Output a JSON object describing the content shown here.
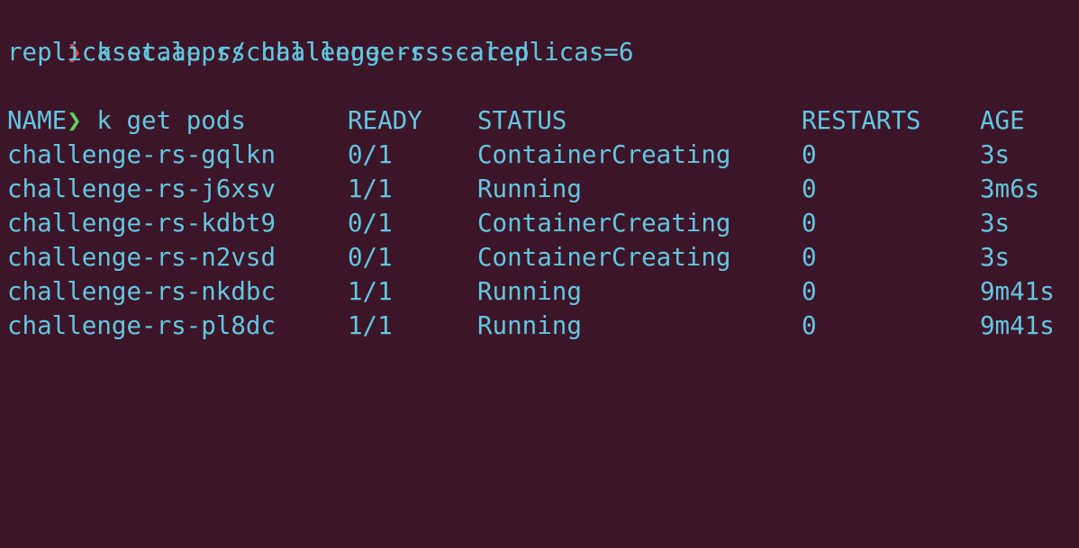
{
  "terminal": {
    "commands": [
      {
        "prompt": "❯",
        "text": "k scale rs challenge-rs --replicas=6",
        "status": "error"
      },
      {
        "output": "replicaset.apps/challenge-rs scaled"
      },
      {
        "prompt": "❯",
        "text": "k get pods",
        "status": "ok"
      }
    ],
    "table": {
      "headers": [
        "NAME",
        "READY",
        "STATUS",
        "RESTARTS",
        "AGE"
      ],
      "rows": [
        [
          "challenge-rs-gqlkn",
          "0/1",
          "ContainerCreating",
          "0",
          "3s"
        ],
        [
          "challenge-rs-j6xsv",
          "1/1",
          "Running",
          "0",
          "3m6s"
        ],
        [
          "challenge-rs-kdbt9",
          "0/1",
          "ContainerCreating",
          "0",
          "3s"
        ],
        [
          "challenge-rs-n2vsd",
          "0/1",
          "ContainerCreating",
          "0",
          "3s"
        ],
        [
          "challenge-rs-nkdbc",
          "1/1",
          "Running",
          "0",
          "9m41s"
        ],
        [
          "challenge-rs-pl8dc",
          "1/1",
          "Running",
          "0",
          "9m41s"
        ]
      ]
    }
  },
  "colors": {
    "background": "#3d1528",
    "text": "#62c7e1",
    "prompt_error": "#e24a4a",
    "prompt_ok": "#5fd35f"
  }
}
